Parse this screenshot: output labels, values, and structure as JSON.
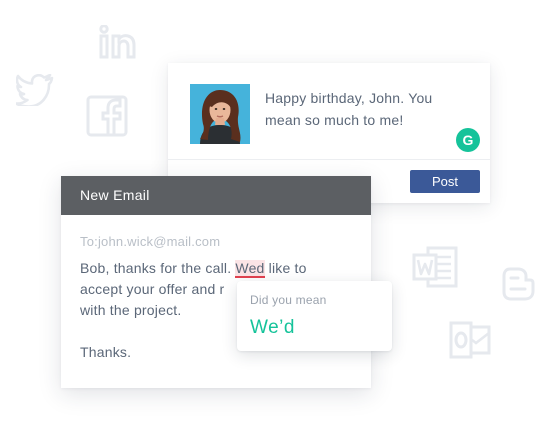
{
  "background_icons": [
    "linkedin-icon",
    "twitter-icon",
    "facebook-icon",
    "word-icon",
    "blogger-icon",
    "outlook-icon"
  ],
  "post": {
    "text": "Happy birthday, John. You mean so much to me!",
    "button_label": "Post",
    "badge_letter": "G"
  },
  "email": {
    "header_title": "New Email",
    "to_label": "To:",
    "to_address": "john.wick@mail.com",
    "line1_before": "Bob, thanks for the call. ",
    "line1_flagged": "Wed",
    "line1_after": " like to",
    "line2": "accept your offer and r",
    "line3": "with the project.",
    "line4": "Thanks."
  },
  "suggestion": {
    "prompt": "Did you mean",
    "fix": "We’d"
  },
  "colors": {
    "grammarly_green": "#15c39a",
    "facebook_blue": "#3b5998",
    "email_header": "#5c5f63",
    "error_red": "#e2424f"
  }
}
